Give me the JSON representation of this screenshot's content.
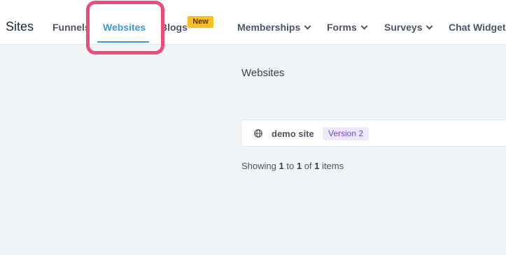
{
  "header": {
    "brand": "Sites",
    "tabs": [
      {
        "label": "Funnels"
      },
      {
        "label": "Websites",
        "active": true
      },
      {
        "label": "Blogs",
        "badge": "New"
      },
      {
        "label": "Memberships",
        "has_dropdown": true
      },
      {
        "label": "Forms",
        "has_dropdown": true
      },
      {
        "label": "Surveys",
        "has_dropdown": true
      },
      {
        "label": "Chat Widget"
      }
    ]
  },
  "main": {
    "title": "Websites",
    "sites": [
      {
        "name": "demo site",
        "version": "Version 2",
        "icon": "globe-icon"
      }
    ],
    "pagination": {
      "prefix": "Showing",
      "from": "1",
      "to_word": "to",
      "to": "1",
      "of_word": "of",
      "total": "1",
      "suffix": "items"
    }
  },
  "colors": {
    "accent": "#3b9ad9",
    "badge_new": "#fbbf24",
    "version_badge_bg": "#ede9fe",
    "version_badge_text": "#7c3aed",
    "highlight": "#ee4b7a"
  }
}
